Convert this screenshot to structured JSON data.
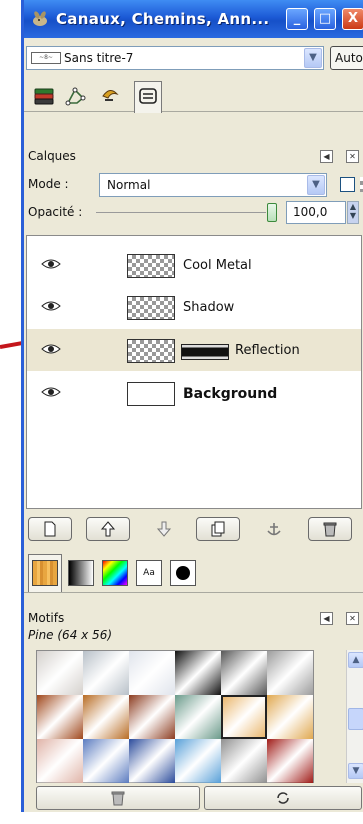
{
  "window": {
    "title": "Canaux, Chemins, Ann...",
    "minimize_label": "_",
    "maximize_label": "□",
    "close_label": "X"
  },
  "image_selector": {
    "value": "Sans titre-7",
    "thumb_text": "~8~",
    "auto_label": "Auto"
  },
  "dock_tabs": [
    {
      "icon": "layers-icon",
      "active": false
    },
    {
      "icon": "channels-icon",
      "active": false
    },
    {
      "icon": "paths-icon",
      "active": false
    },
    {
      "icon": "undo-history-icon",
      "active": true
    }
  ],
  "layers_panel": {
    "title": "Calques",
    "mode_label": "Mode :",
    "mode_value": "Normal",
    "opacity_label": "Opacité :",
    "opacity_value": "100,0",
    "opacity_percent": 100,
    "layers": [
      {
        "name": "Cool Metal",
        "visible": true,
        "thumb": "checker",
        "selected": false,
        "bold": false,
        "has_mask": false
      },
      {
        "name": "Shadow",
        "visible": true,
        "thumb": "checker",
        "selected": false,
        "bold": false,
        "has_mask": false
      },
      {
        "name": "Reflection",
        "visible": true,
        "thumb": "checker",
        "selected": true,
        "bold": false,
        "has_mask": true
      },
      {
        "name": "Background",
        "visible": true,
        "thumb": "white",
        "selected": false,
        "bold": true,
        "has_mask": false
      }
    ]
  },
  "layer_buttons": [
    "new-layer-icon",
    "raise-layer-icon",
    "lower-layer-icon",
    "duplicate-layer-icon",
    "anchor-layer-icon",
    "delete-layer-icon"
  ],
  "resource_tabs": [
    "pattern-icon",
    "gradient-icon",
    "palette-icon",
    "font-icon",
    "brush-icon"
  ],
  "patterns_panel": {
    "title": "Motifs",
    "selected_pattern": "Pine (64 x 56)",
    "swatch_colors": [
      [
        "#d4d0cc",
        "#b8c0c8",
        "#e0e4ec",
        "#101010",
        "#585858",
        "#9c9c9c"
      ],
      [
        "#a0481c",
        "#b86c24",
        "#8c3c20",
        "#6a9a8a",
        "#e8b060",
        "#e0a850"
      ],
      [
        "#e0b4a8",
        "#5c7cc0",
        "#2c4c9c",
        "#58a0d8",
        "#909090",
        "#a01c18"
      ]
    ]
  },
  "bottom_buttons": [
    "delete-pattern-icon",
    "refresh-patterns-icon"
  ]
}
